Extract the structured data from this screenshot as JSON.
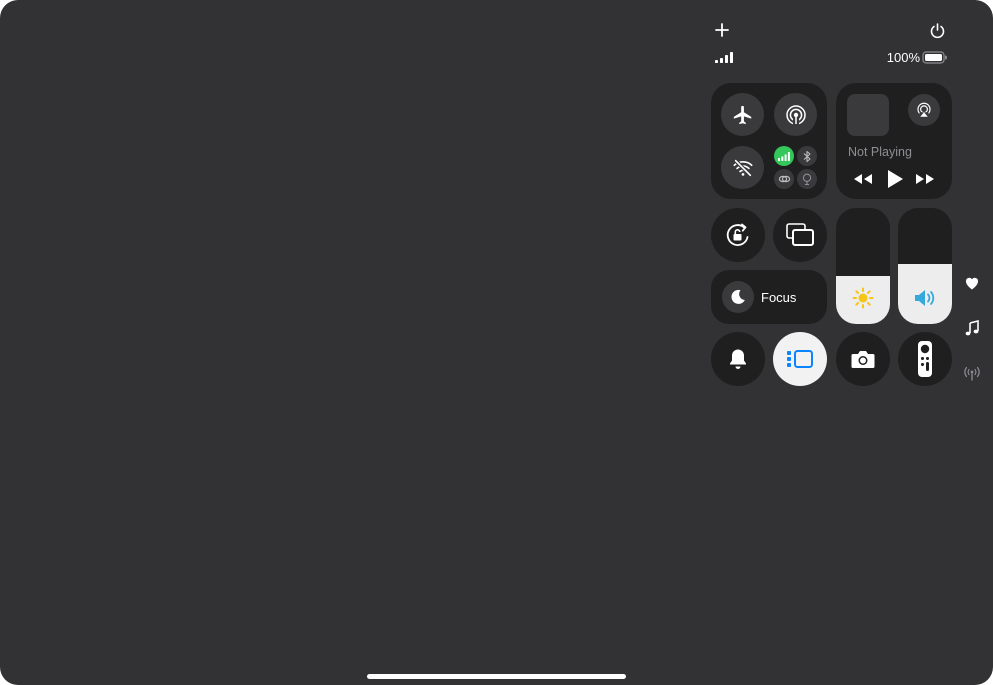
{
  "status": {
    "battery_percent": "100%",
    "battery_level": 1.0,
    "signal_bars": 4
  },
  "connectivity": {
    "airplane_mode": false,
    "airdrop": false,
    "wifi": false,
    "cellular": true,
    "bluetooth": false,
    "cellular_color": "#34c759"
  },
  "now_playing": {
    "status_label": "Not Playing"
  },
  "focus": {
    "label": "Focus"
  },
  "brightness": {
    "level": 0.41,
    "icon_color": "#f5c518"
  },
  "volume": {
    "level": 0.52,
    "icon_color": "#34aadc"
  },
  "stage_manager": {
    "active": true,
    "accent": "#0a84ff"
  },
  "side_icons": [
    "heart-icon",
    "music-icon",
    "antenna-icon"
  ]
}
